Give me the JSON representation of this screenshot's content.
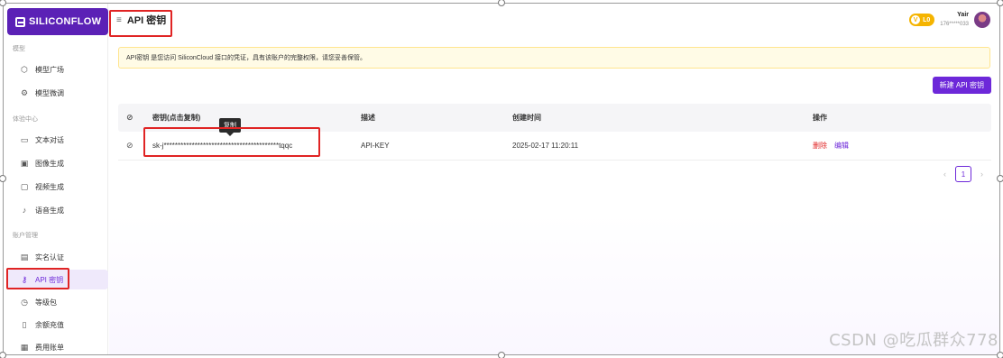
{
  "brand": {
    "name": "SILICONFLOW"
  },
  "sidebar": {
    "sections": [
      {
        "label": "模型"
      },
      {
        "label": "体验中心"
      },
      {
        "label": "账户管理"
      }
    ],
    "items": [
      {
        "label": "模型广场",
        "icon": "cube-icon"
      },
      {
        "label": "模型微调",
        "icon": "tune-icon"
      },
      {
        "label": "文本对话",
        "icon": "chat-icon"
      },
      {
        "label": "图像生成",
        "icon": "image-icon"
      },
      {
        "label": "视频生成",
        "icon": "video-icon"
      },
      {
        "label": "语音生成",
        "icon": "mic-icon"
      },
      {
        "label": "实名认证",
        "icon": "id-card-icon"
      },
      {
        "label": "API 密钥",
        "icon": "key-icon",
        "active": true
      },
      {
        "label": "等级包",
        "icon": "level-icon"
      },
      {
        "label": "余额充值",
        "icon": "recharge-icon"
      },
      {
        "label": "费用账单",
        "icon": "bill-icon"
      }
    ]
  },
  "header": {
    "title": "API 密钥",
    "level": "L0",
    "user_name": "Yair",
    "user_phone": "176*****033"
  },
  "notice": {
    "text": "API密钥 是您访问 SiliconCloud 接口的凭证，具有该账户的完整权限，请您妥善保管。"
  },
  "toolbar": {
    "new_key_label": "新建 API 密钥"
  },
  "table": {
    "headers": [
      "密钥(点击复制)",
      "描述",
      "创建时间",
      "操作"
    ],
    "rows": [
      {
        "key": "sk-j*****************************************tqqc",
        "description": "API-KEY",
        "created": "2025-02-17 11:20:11",
        "delete_label": "删除",
        "edit_label": "编辑"
      }
    ]
  },
  "tooltip": {
    "text": "复制"
  },
  "pagination": {
    "current": "1",
    "prev": "‹",
    "next": "›"
  },
  "watermark": {
    "text": "CSDN @吃瓜群众778"
  },
  "colors": {
    "accent": "#6d28d9",
    "danger": "#e02424",
    "notice_bg": "#fffbe6"
  }
}
